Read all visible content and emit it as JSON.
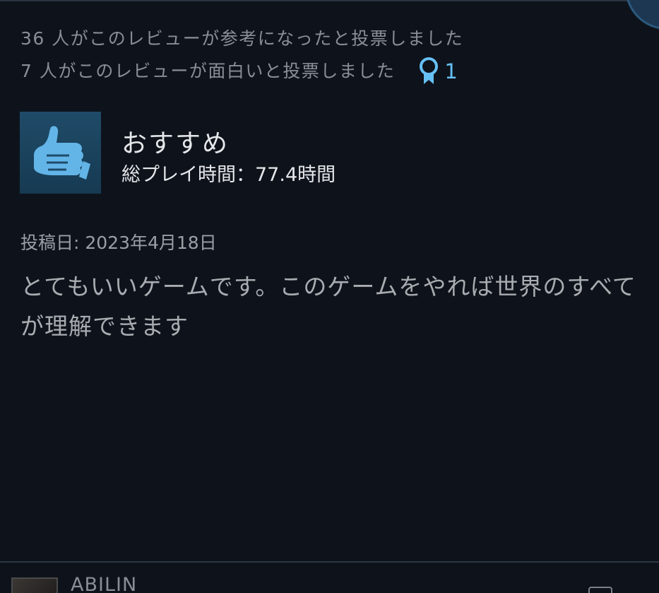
{
  "votes": {
    "helpful": "36 人がこのレビューが参考になったと投票しました",
    "funny": "7 人がこのレビューが面白いと投票しました",
    "award_count": "1",
    "award_icon": "award-ribbon-icon"
  },
  "review": {
    "verdict": "おすすめ",
    "verdict_icon": "thumbs-up-icon",
    "playtime": "総プレイ時間：77.4時間",
    "posted_date": "投稿日: 2023年4月18日",
    "text": "とてもいいゲームです。このゲームをやれば世界のすべてが理解できます"
  },
  "next_review": {
    "author": "ABILIN"
  },
  "colors": {
    "background": "#0e131b",
    "accent": "#66c0f4",
    "thumb_bg": "#1f4b68",
    "muted_text": "#8a8e94",
    "body_text": "#a9acb0"
  }
}
